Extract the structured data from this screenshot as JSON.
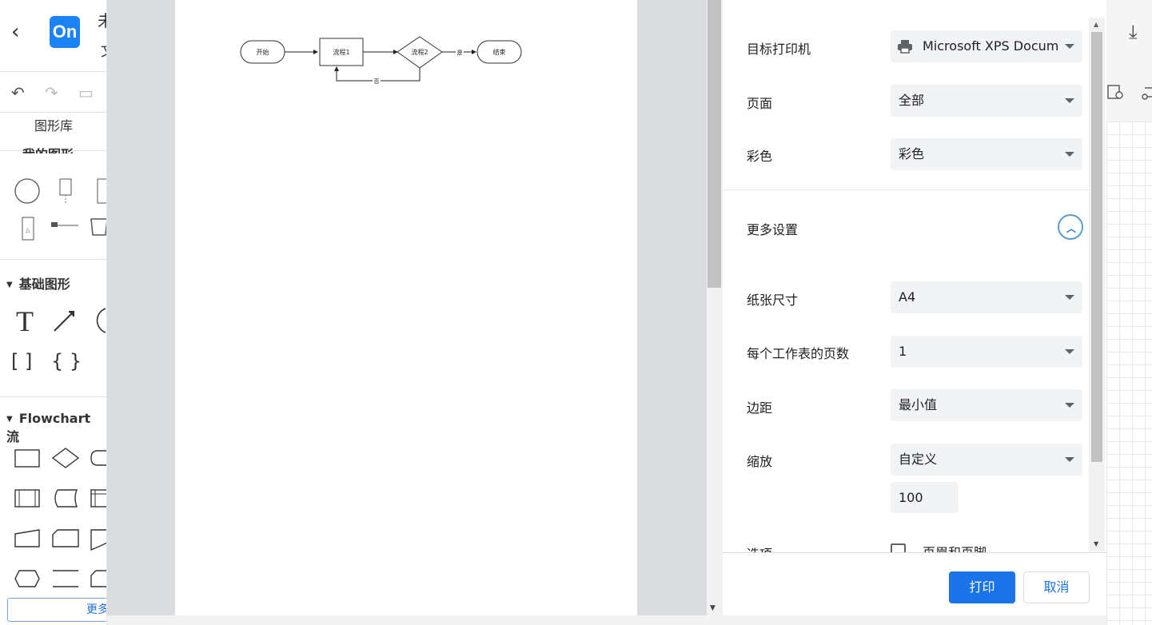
{
  "app": {
    "logo_text": "On",
    "title_fragment": "未",
    "subtitle_fragment": "文",
    "shapes_tab": "图形库",
    "section_mine": "我的图形",
    "section_basic": "基础图形",
    "section_flowchart": "Flowchart 流",
    "more_button": "更多图",
    "brand_color": "#1c83f5"
  },
  "preview": {
    "diagram": {
      "start": "开始",
      "process1": "流程1",
      "decision": "流程2",
      "yes_label": "是",
      "no_label": "否",
      "end": "结束"
    }
  },
  "print": {
    "printer_label": "目标打印机",
    "printer_value": "Microsoft XPS Docum",
    "pages_label": "页面",
    "pages_value": "全部",
    "color_label": "彩色",
    "color_value": "彩色",
    "more_settings": "更多设置",
    "paper_label": "纸张尺寸",
    "paper_value": "A4",
    "pps_label": "每个工作表的页数",
    "pps_value": "1",
    "margin_label": "边距",
    "margin_value": "最小值",
    "scale_label": "缩放",
    "scale_value": "自定义",
    "scale_percent": "100",
    "options_label": "选项",
    "header_footer": "页眉和页脚",
    "print_button": "打印",
    "cancel_button": "取消",
    "accent": "#1a73e8"
  }
}
